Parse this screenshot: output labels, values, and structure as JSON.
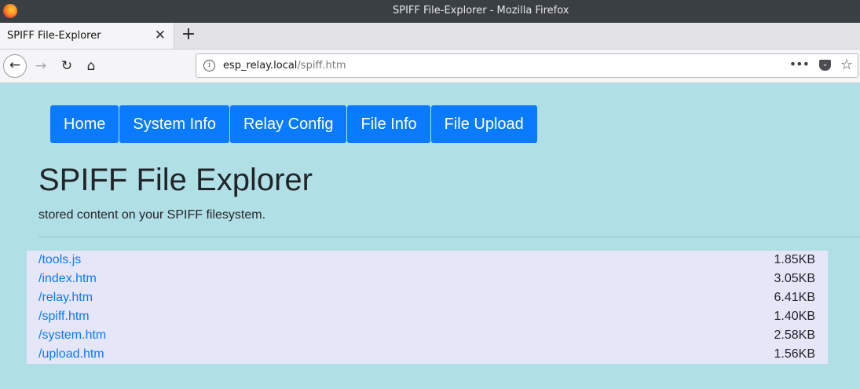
{
  "window": {
    "title": "SPIFF File-Explorer - Mozilla Firefox"
  },
  "tabs": [
    {
      "label": "SPIFF File-Explorer"
    }
  ],
  "navbar": {
    "url_host": "esp_relay.local",
    "url_path": "/spiff.htm"
  },
  "menu": {
    "items": [
      "Home",
      "System Info",
      "Relay Config",
      "File Info",
      "File Upload"
    ]
  },
  "page": {
    "heading": "SPIFF File Explorer",
    "subtitle": "stored content on your SPIFF filesystem."
  },
  "files": [
    {
      "name": "/tools.js",
      "size": "1.85KB"
    },
    {
      "name": "/index.htm",
      "size": "3.05KB"
    },
    {
      "name": "/relay.htm",
      "size": "6.41KB"
    },
    {
      "name": "/spiff.htm",
      "size": "1.40KB"
    },
    {
      "name": "/system.htm",
      "size": "2.58KB"
    },
    {
      "name": "/upload.htm",
      "size": "1.56KB"
    }
  ],
  "colors": {
    "page_background": "#b0dfe5",
    "menu_button": "#0a7bff",
    "file_table_background": "#e6e6f9",
    "link": "#0a7bff"
  },
  "icons": [
    "firefox-logo-icon",
    "close-icon",
    "plus-icon",
    "back-arrow-icon",
    "forward-arrow-icon",
    "reload-icon",
    "home-icon",
    "info-icon",
    "more-dots-icon",
    "pocket-icon",
    "star-icon"
  ]
}
